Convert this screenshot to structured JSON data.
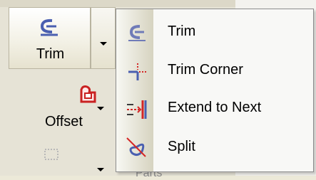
{
  "ribbon": {
    "trim_button": {
      "label": "Trim",
      "icon": "trim-icon"
    },
    "offset_button": {
      "label": "Offset",
      "icon": "offset-icon"
    },
    "partial_text": "Parts"
  },
  "menu": {
    "items": [
      {
        "label": "Trim",
        "icon": "trim-icon"
      },
      {
        "label": "Trim Corner",
        "icon": "trim-corner-icon"
      },
      {
        "label": "Extend to Next",
        "icon": "extend-to-next-icon"
      },
      {
        "label": "Split",
        "icon": "split-icon"
      }
    ]
  },
  "colors": {
    "icon_blue": "#4a5fb0",
    "icon_red": "#d42626",
    "menu_background": "#f8f8f6",
    "menu_border": "#8c8c8c"
  }
}
